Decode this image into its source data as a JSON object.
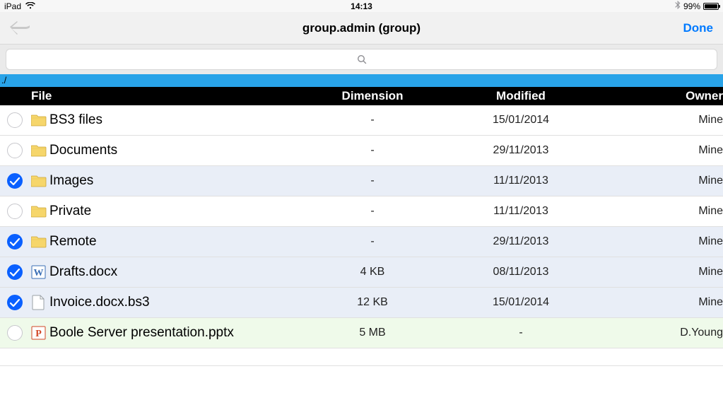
{
  "statusbar": {
    "carrier": "iPad",
    "time": "14:13",
    "battery_pct": "99%"
  },
  "navbar": {
    "title": "group.admin (group)",
    "done": "Done"
  },
  "search": {
    "placeholder": ""
  },
  "path": "./",
  "columns": {
    "file": "File",
    "dimension": "Dimension",
    "modified": "Modified",
    "owner": "Owner"
  },
  "rows": [
    {
      "selected": false,
      "highlight": false,
      "icon": "folder",
      "name": "BS3 files",
      "dimension": "-",
      "modified": "15/01/2014",
      "owner": "Mine"
    },
    {
      "selected": false,
      "highlight": false,
      "icon": "folder",
      "name": "Documents",
      "dimension": "-",
      "modified": "29/11/2013",
      "owner": "Mine"
    },
    {
      "selected": true,
      "highlight": false,
      "icon": "folder",
      "name": "Images",
      "dimension": "-",
      "modified": "11/11/2013",
      "owner": "Mine"
    },
    {
      "selected": false,
      "highlight": false,
      "icon": "folder",
      "name": "Private",
      "dimension": "-",
      "modified": "11/11/2013",
      "owner": "Mine"
    },
    {
      "selected": true,
      "highlight": false,
      "icon": "folder",
      "name": "Remote",
      "dimension": "-",
      "modified": "29/11/2013",
      "owner": "Mine"
    },
    {
      "selected": true,
      "highlight": false,
      "icon": "word",
      "name": "Drafts.docx",
      "dimension": "4 KB",
      "modified": "08/11/2013",
      "owner": "Mine"
    },
    {
      "selected": true,
      "highlight": false,
      "icon": "file",
      "name": "Invoice.docx.bs3",
      "dimension": "12 KB",
      "modified": "15/01/2014",
      "owner": "Mine"
    },
    {
      "selected": false,
      "highlight": true,
      "icon": "ppt",
      "name": "Boole Server presentation.pptx",
      "dimension": "5 MB",
      "modified": "-",
      "owner": "D.Young"
    }
  ]
}
